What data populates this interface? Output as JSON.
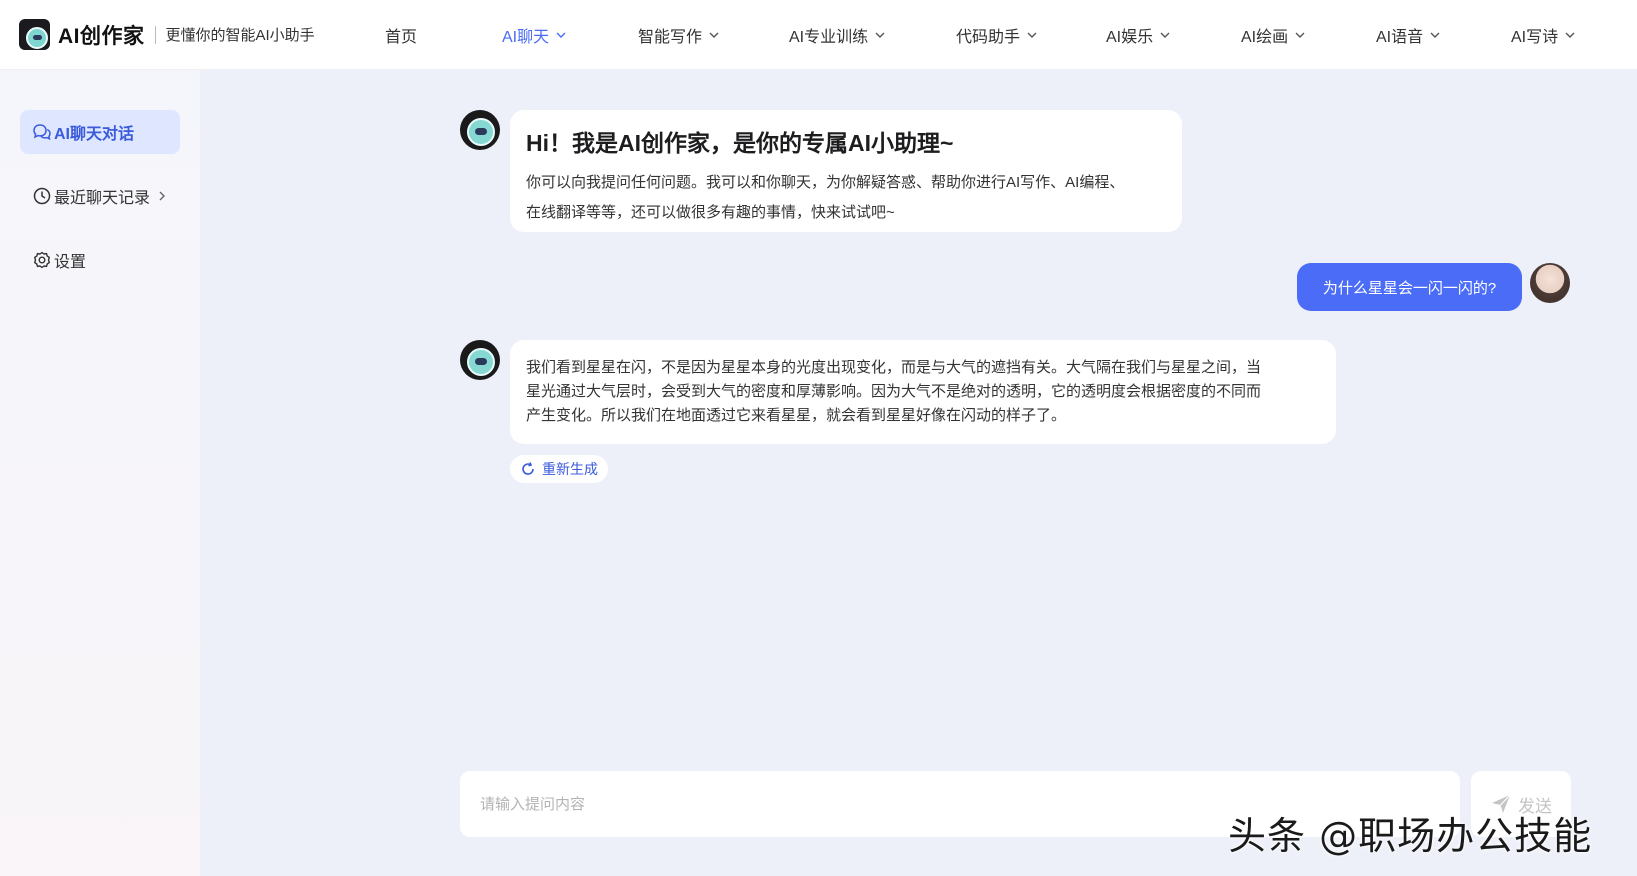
{
  "header": {
    "logo_text": "AI创作家",
    "slogan": "更懂你的智能AI小助手",
    "nav": [
      {
        "label": "首页",
        "has_dropdown": false,
        "active": false
      },
      {
        "label": "AI聊天",
        "has_dropdown": true,
        "active": true
      },
      {
        "label": "智能写作",
        "has_dropdown": true,
        "active": false
      },
      {
        "label": "AI专业训练",
        "has_dropdown": true,
        "active": false
      },
      {
        "label": "代码助手",
        "has_dropdown": true,
        "active": false
      },
      {
        "label": "AI娱乐",
        "has_dropdown": true,
        "active": false
      },
      {
        "label": "AI绘画",
        "has_dropdown": true,
        "active": false
      },
      {
        "label": "AI语音",
        "has_dropdown": true,
        "active": false
      },
      {
        "label": "AI写诗",
        "has_dropdown": true,
        "active": false
      }
    ]
  },
  "sidebar": {
    "items": [
      {
        "label": "AI聊天对话",
        "icon": "chat-bubbles-icon",
        "active": true
      },
      {
        "label": "最近聊天记录",
        "icon": "clock-icon",
        "active": false
      },
      {
        "label": "设置",
        "icon": "gear-icon",
        "active": false
      }
    ]
  },
  "chat": {
    "greeting": {
      "title": "Hi！我是AI创作家，是你的专属AI小助理~",
      "line1": "你可以向我提问任何问题。我可以和你聊天，为你解疑答惑、帮助你进行AI写作、AI编程、",
      "line2": "在线翻译等等，还可以做很多有趣的事情，快来试试吧~"
    },
    "user_message": "为什么星星会一闪一闪的?",
    "answer": {
      "line1": "我们看到星星在闪，不是因为星星本身的光度出现变化，而是与大气的遮挡有关。大气隔在我们与星星之间，当",
      "line2": "星光通过大气层时，会受到大气的密度和厚薄影响。因为大气不是绝对的透明，它的透明度会根据密度的不同而",
      "line3": "产生变化。所以我们在地面透过它来看星星，就会看到星星好像在闪动的样子了。"
    },
    "regenerate_label": "重新生成"
  },
  "composer": {
    "placeholder": "请输入提问内容",
    "value": "",
    "send_label": "发送"
  },
  "watermark": "头条 @职场办公技能",
  "colors": {
    "accent": "#4a6cf7",
    "background": "#eef0f9",
    "sidebar_active_bg": "#dfe6ff"
  }
}
